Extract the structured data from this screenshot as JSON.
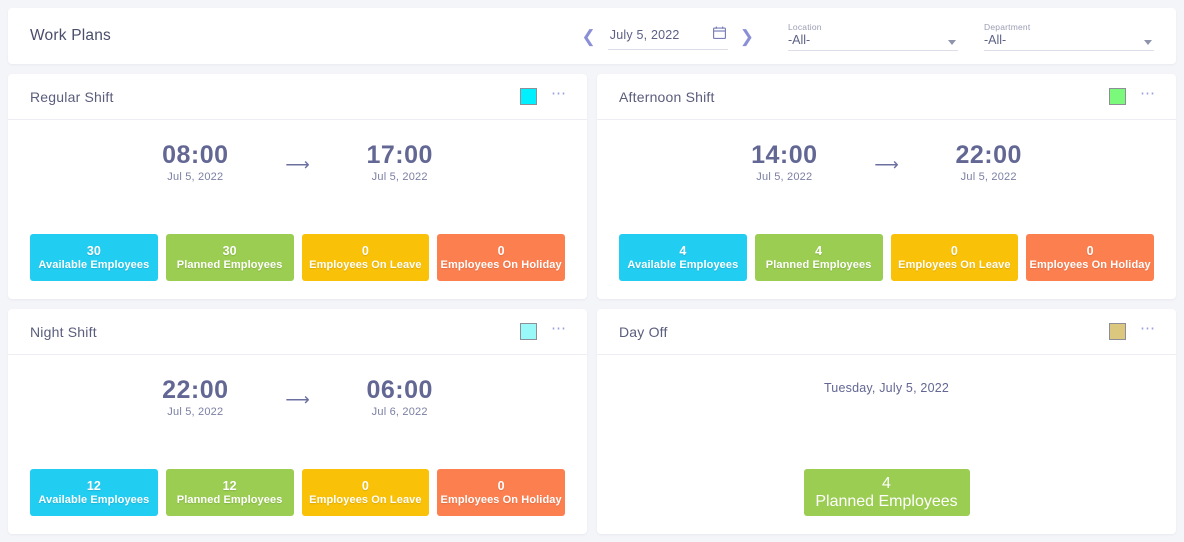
{
  "header": {
    "title": "Work Plans",
    "prev_icon": "chevron-left-icon",
    "next_icon": "chevron-right-icon",
    "date_value": "July 5, 2022",
    "calendar_icon": "calendar-icon",
    "location": {
      "label": "Location",
      "value": "-All-"
    },
    "department": {
      "label": "Department",
      "value": "-All-"
    }
  },
  "colors": {
    "available": "#22cdf2",
    "planned": "#9acd51",
    "on_leave": "#f9c108",
    "on_holiday": "#fc7f50",
    "page_bg": "#f4f5f9",
    "card_bg": "#ffffff",
    "title_text": "#5a5d7c",
    "time_text": "#636793",
    "dots": "#9aa0e0"
  },
  "tile_captions": {
    "available": "Available Employees",
    "planned": "Planned Employees",
    "on_leave": "Employees On Leave",
    "on_holiday": "Employees On Holiday"
  },
  "cards": [
    {
      "title": "Regular Shift",
      "swatch_color": "#00f0ff",
      "menu_icon": "ellipsis-icon",
      "start_time": "08:00",
      "start_date": "Jul 5, 2022",
      "arrow_icon": "arrow-right-icon",
      "end_time": "17:00",
      "end_date": "Jul 5, 2022",
      "stats": {
        "available": "30",
        "planned": "30",
        "on_leave": "0",
        "on_holiday": "0"
      }
    },
    {
      "title": "Afternoon Shift",
      "swatch_color": "#7bf97b",
      "menu_icon": "ellipsis-icon",
      "start_time": "14:00",
      "start_date": "Jul 5, 2022",
      "arrow_icon": "arrow-right-icon",
      "end_time": "22:00",
      "end_date": "Jul 5, 2022",
      "stats": {
        "available": "4",
        "planned": "4",
        "on_leave": "0",
        "on_holiday": "0"
      }
    },
    {
      "title": "Night Shift",
      "swatch_color": "#99f9f9",
      "menu_icon": "ellipsis-icon",
      "start_time": "22:00",
      "start_date": "Jul 5, 2022",
      "arrow_icon": "arrow-right-icon",
      "end_time": "06:00",
      "end_date": "Jul 6, 2022",
      "stats": {
        "available": "12",
        "planned": "12",
        "on_leave": "0",
        "on_holiday": "0"
      }
    },
    {
      "title": "Day Off",
      "swatch_color": "#dbc77e",
      "menu_icon": "ellipsis-icon",
      "full_date": "Tuesday, July 5, 2022",
      "stats": {
        "planned": "4"
      }
    }
  ]
}
